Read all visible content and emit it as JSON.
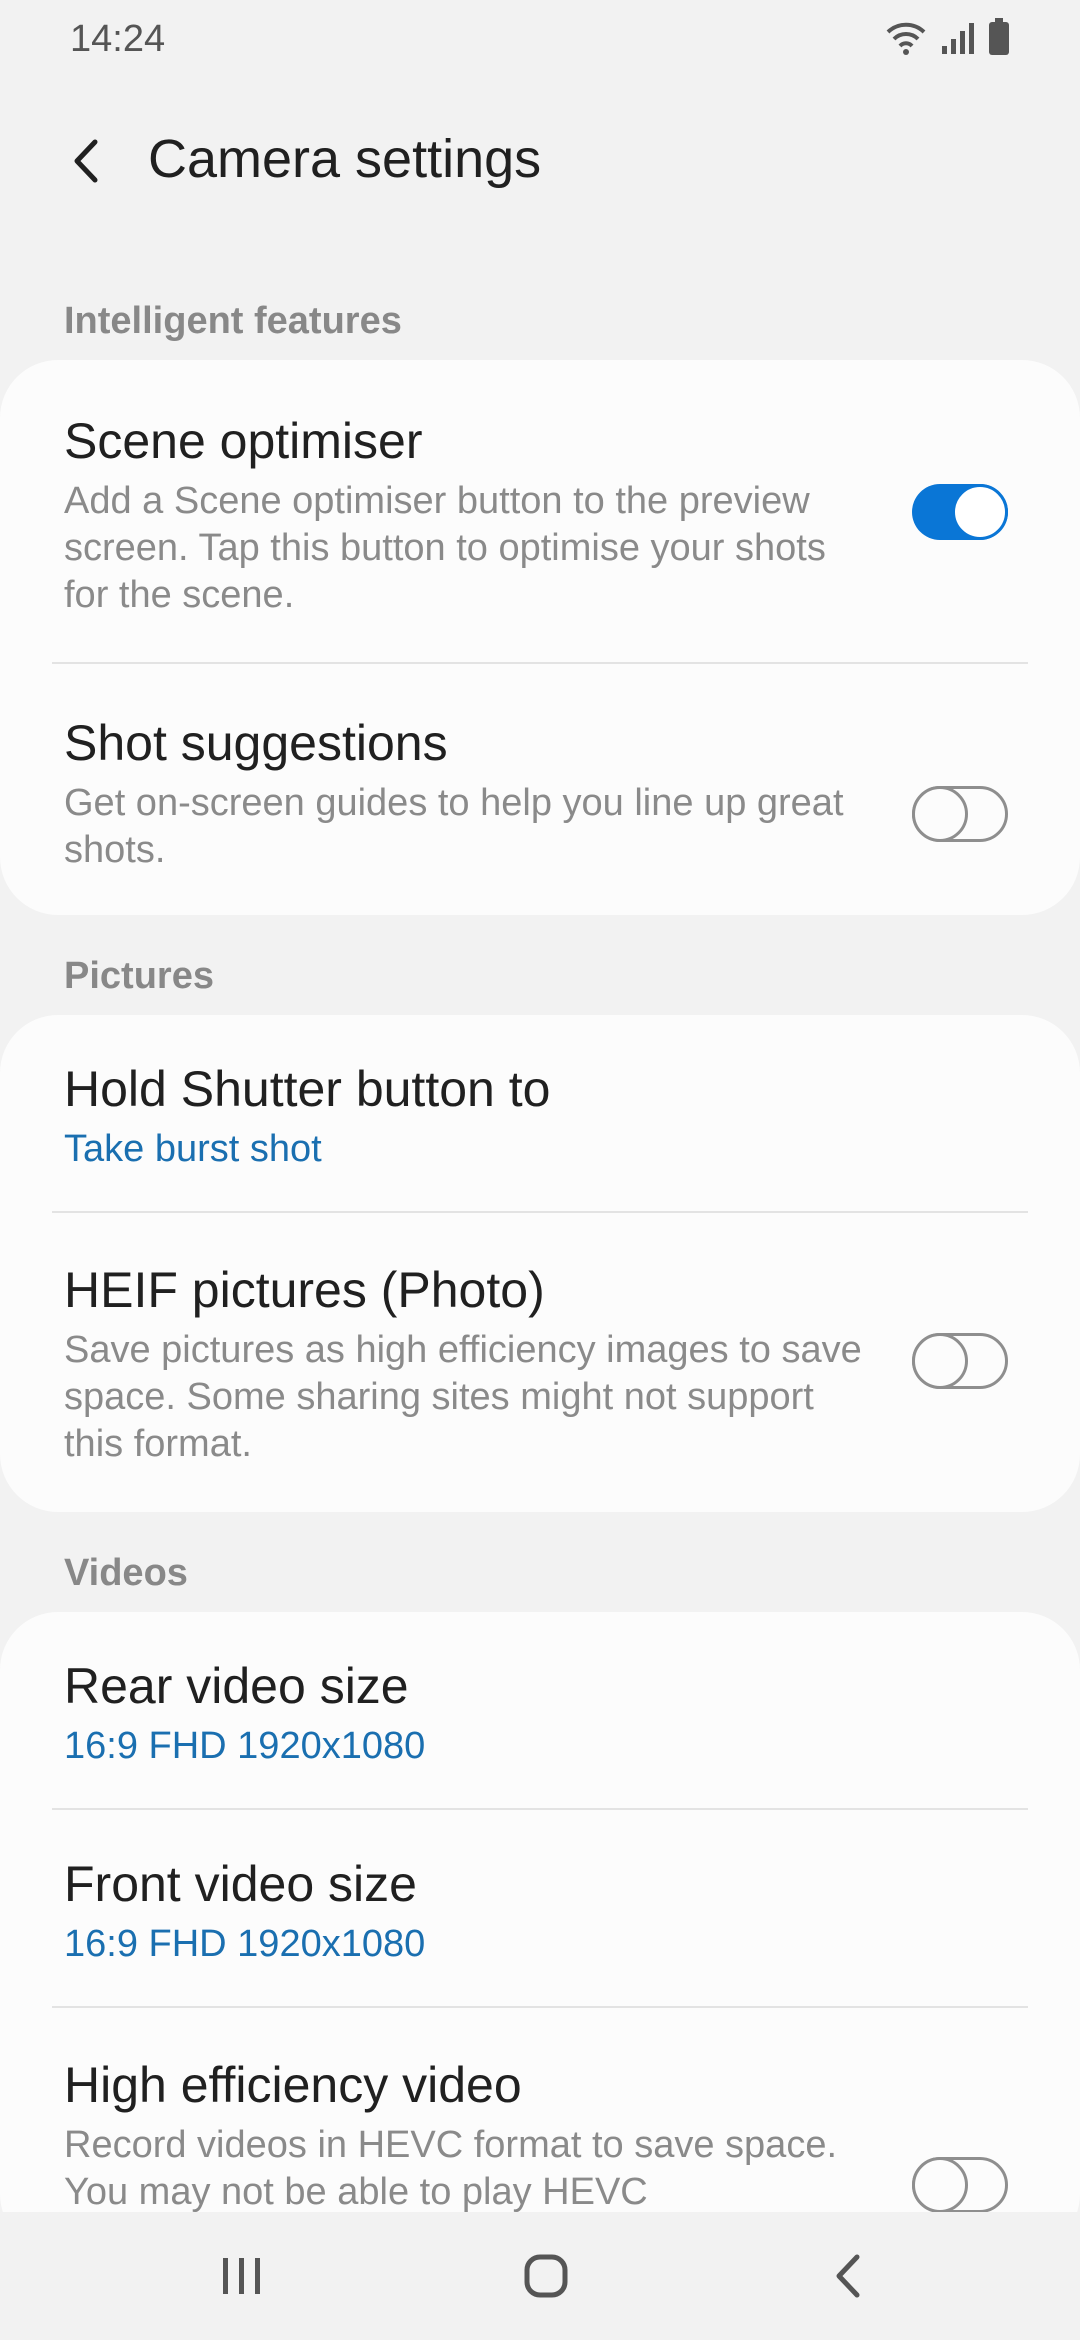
{
  "status_bar": {
    "time": "14:24",
    "icons": [
      "wifi-icon",
      "signal-icon",
      "battery-icon"
    ]
  },
  "header": {
    "title": "Camera settings",
    "back_icon": "chevron-left-icon"
  },
  "sections": {
    "intelligent": {
      "label": "Intelligent features",
      "scene_optimiser": {
        "title": "Scene optimiser",
        "description": "Add a Scene optimiser button to the preview screen. Tap this button to optimise your shots for the scene.",
        "enabled": true
      },
      "shot_suggestions": {
        "title": "Shot suggestions",
        "description": "Get on-screen guides to help you line up great shots.",
        "enabled": false
      }
    },
    "pictures": {
      "label": "Pictures",
      "hold_shutter": {
        "title": "Hold Shutter button to",
        "value": "Take burst shot"
      },
      "heif": {
        "title": "HEIF pictures (Photo)",
        "description": "Save pictures as high efficiency images to save space. Some sharing sites might not support this format.",
        "enabled": false
      }
    },
    "videos": {
      "label": "Videos",
      "rear_video_size": {
        "title": "Rear video size",
        "value": "16:9 FHD 1920x1080"
      },
      "front_video_size": {
        "title": "Front video size",
        "value": "16:9 FHD 1920x1080"
      },
      "hevc": {
        "title": "High efficiency video",
        "description": "Record videos in HEVC format to save space. You may not be able to play HEVC",
        "enabled": false
      }
    }
  },
  "nav_bar": {
    "icons": [
      "recent-apps-icon",
      "home-icon",
      "back-icon"
    ]
  },
  "colors": {
    "accent": "#0a76d6",
    "subtext_link": "#1a6fb0",
    "background": "#f2f2f2",
    "card": "#fcfcfc"
  }
}
